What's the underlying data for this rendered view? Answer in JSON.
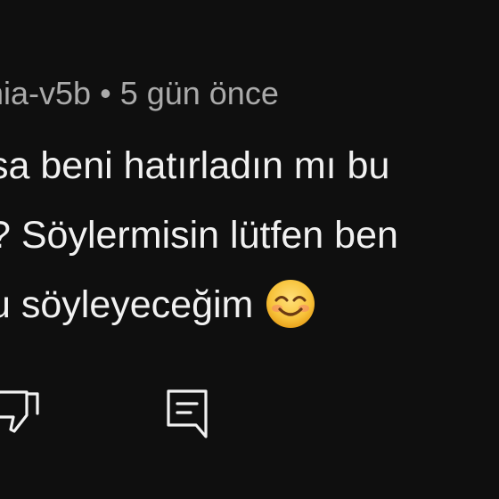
{
  "comment": {
    "author": "nia-v5b",
    "separator": "•",
    "timestamp": "5 gün önce",
    "lines": [
      "sa beni hatırladın mı bu",
      "? Söylermisin lütfen ben",
      "u söyleyeceğim"
    ],
    "emoji": "smiling-face-with-smiling-eyes"
  },
  "actions": {
    "dislike_icon": "thumb-down-icon",
    "reply_icon": "comment-reply-icon"
  },
  "colors": {
    "background": "#0f0f0f",
    "text": "#f1f1f1",
    "meta": "#aaaaaa",
    "emoji_face": "#f7c23a"
  }
}
